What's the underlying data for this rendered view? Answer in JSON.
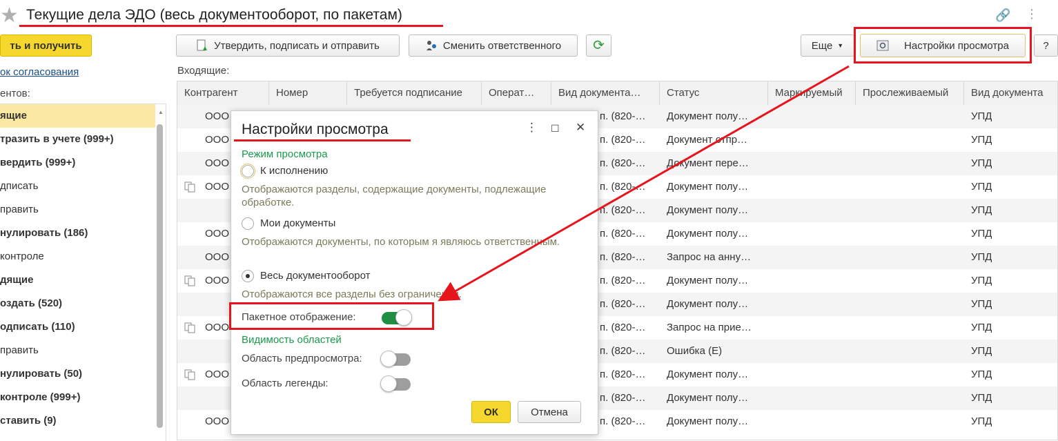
{
  "window": {
    "title": "Текущие дела ЭДО (весь документооборот, по пакетам)"
  },
  "toolbar": {
    "send_receive": "ть и получить",
    "approve_sign_send": "Утвердить, подписать и отправить",
    "change_responsible": "Сменить ответственного",
    "more": "Еще",
    "view_settings": "Настройки просмотра",
    "help": "?"
  },
  "left": {
    "link": "ок согласования",
    "caption": "ентов:",
    "items": [
      {
        "label": "ящие"
      },
      {
        "label": "тразить в учете (999+)"
      },
      {
        "label": "вердить (999+)"
      },
      {
        "label": "дписать"
      },
      {
        "label": "править"
      },
      {
        "label": "нулировать (186)"
      },
      {
        "label": " контроле"
      },
      {
        "label": "дящие"
      },
      {
        "label": "оздать (520)"
      },
      {
        "label": "одписать (110)"
      },
      {
        "label": "править"
      },
      {
        "label": "нулировать (50)"
      },
      {
        "label": " контроле (999+)"
      },
      {
        "label": "ставить (9)"
      }
    ]
  },
  "grid": {
    "caption": "Входящие:",
    "columns": [
      "Контрагент",
      "Номер",
      "Требуется подписание",
      "Операт…",
      "Вид документа…",
      "Статус",
      "Маркируемый",
      "Прослеживаемый",
      "Вид документа"
    ],
    "rows": [
      {
        "counterparty": "ООО",
        "doc_kind": "п. (820-…",
        "status": "Документ полу…",
        "doc_type": "УПД"
      },
      {
        "counterparty": "ООО",
        "doc_kind": "п. (820-…",
        "status": "Документ отпр…",
        "doc_type": "УПД"
      },
      {
        "counterparty": "ООО",
        "doc_kind": "п. (820-…",
        "status": "Документ пере…",
        "doc_type": "УПД"
      },
      {
        "counterparty": "ООО",
        "doc_kind": "п. (820-…",
        "status": "Документ полу…",
        "doc_type": "УПД"
      },
      {
        "counterparty": "",
        "doc_kind": "п. (820-…",
        "status": "Документ полу…",
        "doc_type": "УПД"
      },
      {
        "counterparty": "ООО",
        "doc_kind": "п. (820-…",
        "status": "Документ полу…",
        "doc_type": "УПД"
      },
      {
        "counterparty": "ООО",
        "doc_kind": "п. (820-…",
        "status": "Запрос на анну…",
        "doc_type": "УПД"
      },
      {
        "counterparty": "ООО",
        "doc_kind": "п. (820-…",
        "status": "Документ полу…",
        "doc_type": "УПД"
      },
      {
        "counterparty": "",
        "doc_kind": "п. (820-…",
        "status": "Документ полу…",
        "doc_type": "УПД"
      },
      {
        "counterparty": "ООО",
        "doc_kind": "п. (820-…",
        "status": "Запрос на прие…",
        "doc_type": "УПД"
      },
      {
        "counterparty": "",
        "doc_kind": "п. (820-…",
        "status": "Ошибка (Е)",
        "doc_type": "УПД"
      },
      {
        "counterparty": "ООО",
        "doc_kind": "п. (820-…",
        "status": "Документ полу…",
        "doc_type": "УПД"
      },
      {
        "counterparty": "",
        "doc_kind": "п. (820-…",
        "status": "Документ полу…",
        "doc_type": "УПД"
      },
      {
        "counterparty": "ООО",
        "doc_kind": "п. (820-…",
        "status": "Документ полу…",
        "doc_type": "УПД"
      }
    ]
  },
  "dialog": {
    "title": "Настройки просмотра",
    "view_mode_section": "Режим просмотра",
    "option1_label": "К исполнению",
    "option1_desc": "Отображаются разделы, содержащие документы, подлежащие обработке.",
    "option2_label": "Мои документы",
    "option2_desc": "Отображаются документы, по которым я являюсь ответственным.",
    "option3_label": "Весь документооборот",
    "option3_desc": "Отображаются все разделы без ограничений.",
    "batch_label": "Пакетное отображение:",
    "visibility_section": "Видимость областей",
    "preview_label": "Область предпросмотра:",
    "legend_label": "Область легенды:",
    "ok": "ОК",
    "cancel": "Отмена"
  },
  "colors": {
    "accent_green": "#1a9a4b",
    "annotation_red": "#e8141c",
    "ok_yellow": "#f6d72d"
  }
}
